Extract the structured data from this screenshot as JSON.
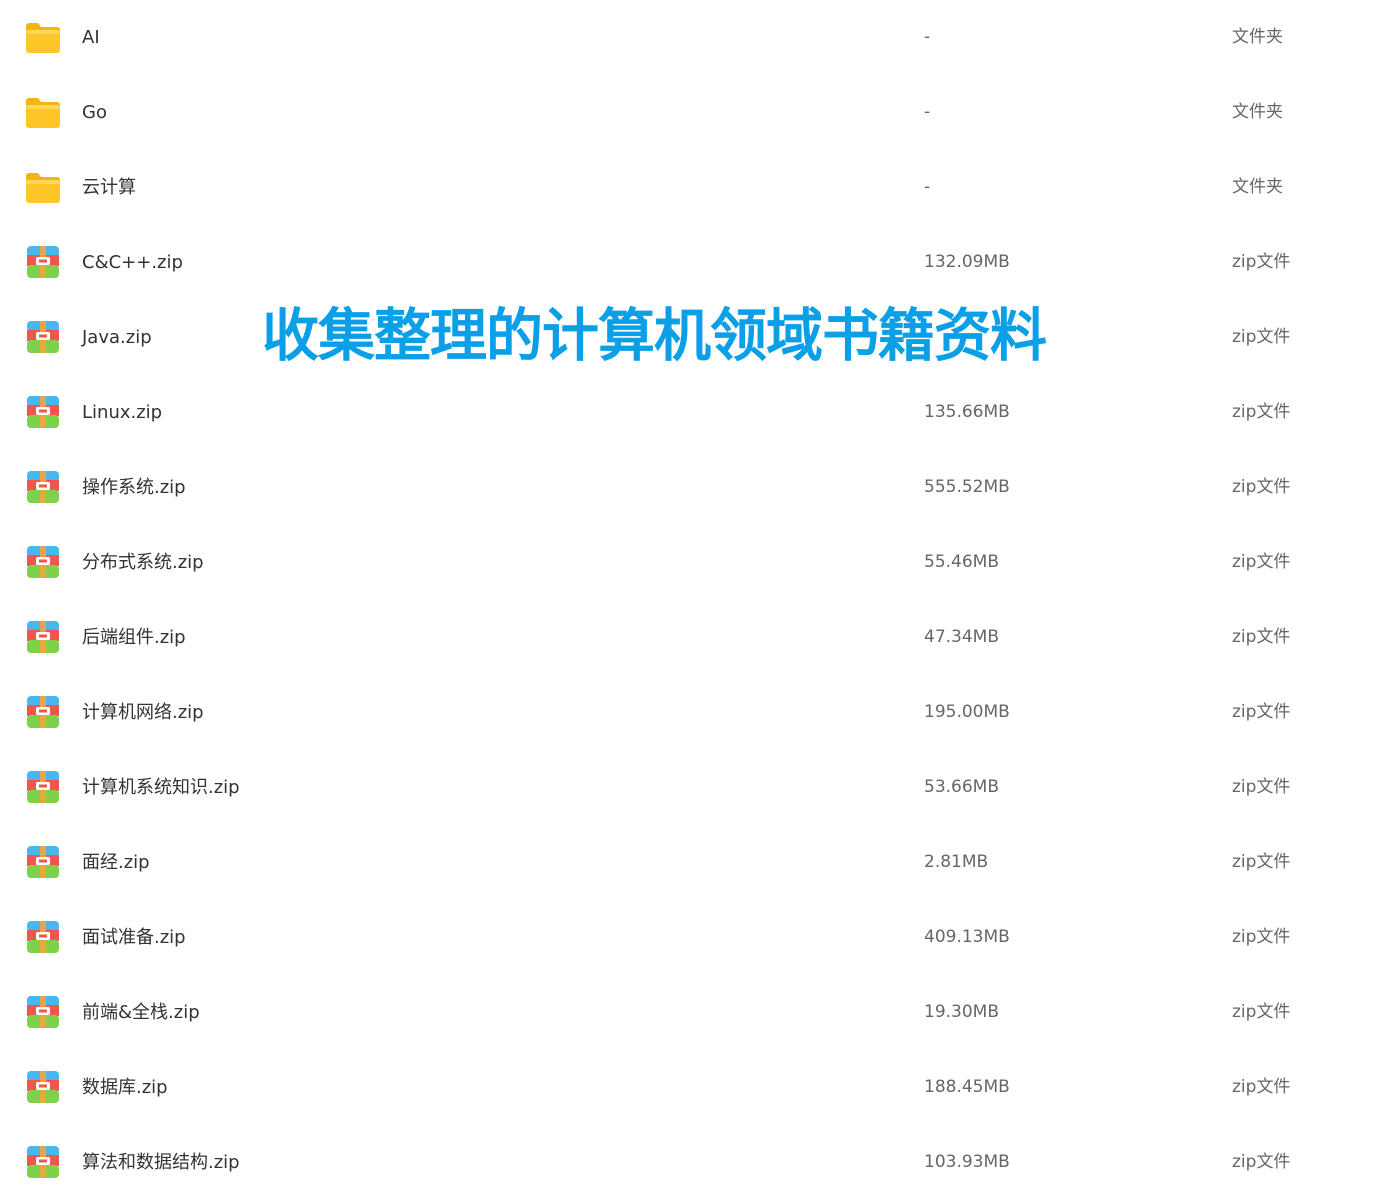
{
  "overlay_title": "收集整理的计算机领域书籍资料",
  "colors": {
    "folder": "#ffc629",
    "archive_top": "#4ab6f0",
    "archive_middle": "#f0564c",
    "archive_bottom": "#7ed14a",
    "title": "#0a9fe6"
  },
  "files": [
    {
      "name": "AI",
      "size": "-",
      "type": "文件夹",
      "icon": "folder-icon"
    },
    {
      "name": "Go",
      "size": "-",
      "type": "文件夹",
      "icon": "folder-icon"
    },
    {
      "name": "云计算",
      "size": "-",
      "type": "文件夹",
      "icon": "folder-icon"
    },
    {
      "name": "C&C++.zip",
      "size": "132.09MB",
      "type": "zip文件",
      "icon": "zip-archive-icon"
    },
    {
      "name": "Java.zip",
      "size": "",
      "type": "zip文件",
      "icon": "zip-archive-icon"
    },
    {
      "name": "Linux.zip",
      "size": "135.66MB",
      "type": "zip文件",
      "icon": "zip-archive-icon"
    },
    {
      "name": "操作系统.zip",
      "size": "555.52MB",
      "type": "zip文件",
      "icon": "zip-archive-icon"
    },
    {
      "name": "分布式系统.zip",
      "size": "55.46MB",
      "type": "zip文件",
      "icon": "zip-archive-icon"
    },
    {
      "name": "后端组件.zip",
      "size": "47.34MB",
      "type": "zip文件",
      "icon": "zip-archive-icon"
    },
    {
      "name": "计算机网络.zip",
      "size": "195.00MB",
      "type": "zip文件",
      "icon": "zip-archive-icon"
    },
    {
      "name": "计算机系统知识.zip",
      "size": "53.66MB",
      "type": "zip文件",
      "icon": "zip-archive-icon"
    },
    {
      "name": "面经.zip",
      "size": "2.81MB",
      "type": "zip文件",
      "icon": "zip-archive-icon"
    },
    {
      "name": "面试准备.zip",
      "size": "409.13MB",
      "type": "zip文件",
      "icon": "zip-archive-icon"
    },
    {
      "name": "前端&全栈.zip",
      "size": "19.30MB",
      "type": "zip文件",
      "icon": "zip-archive-icon"
    },
    {
      "name": "数据库.zip",
      "size": "188.45MB",
      "type": "zip文件",
      "icon": "zip-archive-icon"
    },
    {
      "name": "算法和数据结构.zip",
      "size": "103.93MB",
      "type": "zip文件",
      "icon": "zip-archive-icon"
    }
  ]
}
